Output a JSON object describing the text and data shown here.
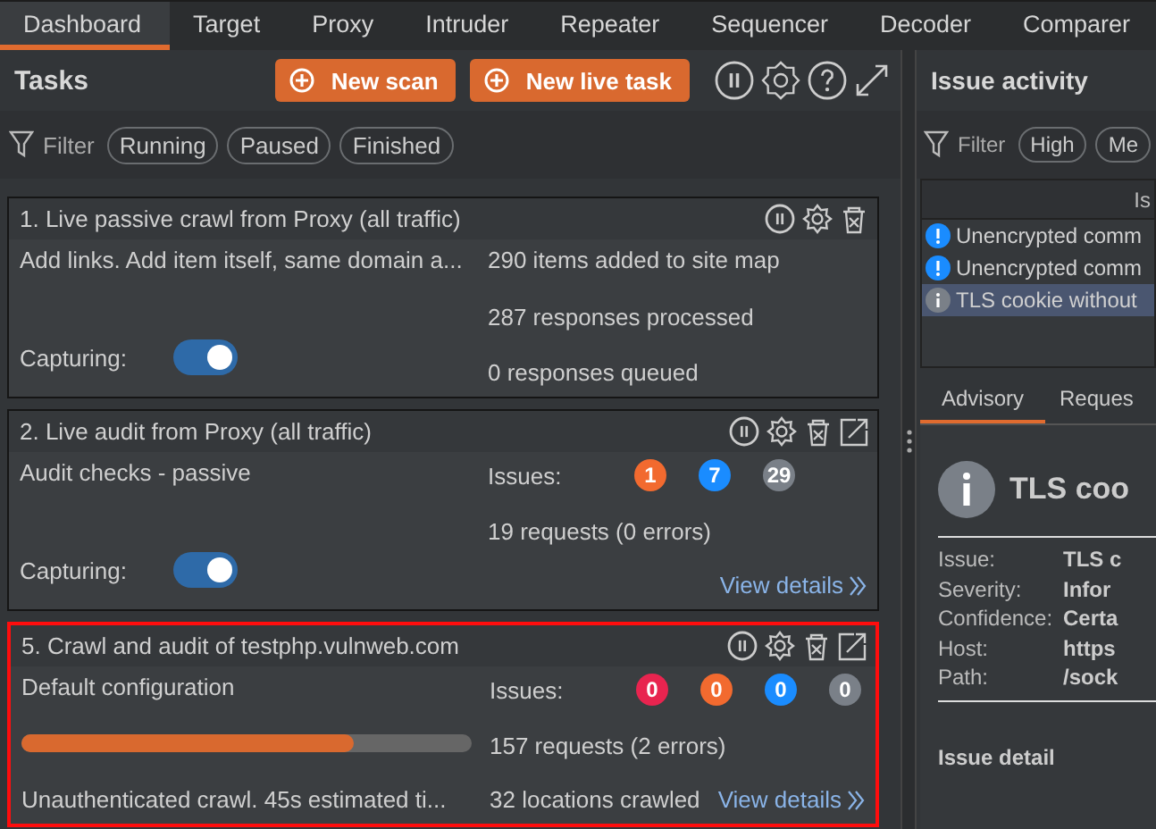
{
  "tabs": [
    {
      "label": "Dashboard",
      "selected": true
    },
    {
      "label": "Target",
      "selected": false
    },
    {
      "label": "Proxy",
      "selected": false
    },
    {
      "label": "Intruder",
      "selected": false
    },
    {
      "label": "Repeater",
      "selected": false
    },
    {
      "label": "Sequencer",
      "selected": false
    },
    {
      "label": "Decoder",
      "selected": false
    },
    {
      "label": "Comparer",
      "selected": false
    }
  ],
  "tasks_panel": {
    "title": "Tasks",
    "buttons": [
      "New scan",
      "New live task"
    ],
    "filter": {
      "label": "Filter",
      "chips": [
        "Running",
        "Paused",
        "Finished"
      ]
    },
    "tasks": [
      {
        "title": "1. Live passive crawl from Proxy (all traffic)",
        "selected": false,
        "popout": false,
        "left": [
          {
            "kind": "text",
            "text": "Add links. Add item itself, same domain a..."
          },
          {
            "kind": "toggle",
            "label": "Capturing:",
            "on": true
          }
        ],
        "right": [
          {
            "kind": "text",
            "text": "290 items added to site map"
          },
          {
            "kind": "text",
            "text": "287 responses processed"
          },
          {
            "kind": "text",
            "text": "0 responses queued"
          }
        ]
      },
      {
        "title": "2. Live audit from Proxy (all traffic)",
        "selected": false,
        "popout": true,
        "left": [
          {
            "kind": "text",
            "text": "Audit checks - passive"
          },
          {
            "kind": "toggle",
            "label": "Capturing:",
            "on": true
          }
        ],
        "right": [
          {
            "kind": "issues",
            "label": "Issues:",
            "counts": [
              {
                "value": "1",
                "color": "#f26a2f"
              },
              {
                "value": "7",
                "color": "#1a8cff"
              },
              {
                "value": "29",
                "color": "#7a8088"
              }
            ]
          },
          {
            "kind": "text",
            "text": "19 requests (0 errors)"
          },
          {
            "kind": "text",
            "link": "View details"
          }
        ]
      },
      {
        "title": "5. Crawl and audit of testphp.vulnweb.com",
        "selected": true,
        "popout": true,
        "left": [
          {
            "kind": "text",
            "text": "Default configuration"
          },
          {
            "kind": "progress",
            "level": 0.74
          },
          {
            "kind": "text",
            "text": "Unauthenticated crawl. 45s estimated ti..."
          }
        ],
        "right": [
          {
            "kind": "issues",
            "label": "Issues:",
            "counts": [
              {
                "value": "0",
                "color": "#e8244f"
              },
              {
                "value": "0",
                "color": "#f26a2f"
              },
              {
                "value": "0",
                "color": "#1a8cff"
              },
              {
                "value": "0",
                "color": "#7a8088"
              }
            ]
          },
          {
            "kind": "text",
            "text": "157 requests (2 errors)"
          },
          {
            "kind": "text",
            "text": "32 locations crawled",
            "link": "View details"
          }
        ]
      }
    ]
  },
  "issue_activity": {
    "title": "Issue activity",
    "filter": {
      "label": "Filter",
      "chips": [
        "High",
        "Me"
      ]
    },
    "table": {
      "column_1": "Is",
      "rows": [
        {
          "text": "Unencrypted comm",
          "color": "#1a8cff",
          "selected": false
        },
        {
          "text": "Unencrypted comm",
          "color": "#1a8cff",
          "selected": false
        },
        {
          "text": "TLS cookie without",
          "color": "#7a8088",
          "selected": true
        }
      ]
    },
    "detail_tabs": [
      {
        "label": "Advisory",
        "selected": true
      },
      {
        "label": "Reques",
        "selected": false
      }
    ],
    "advisory": {
      "title": "TLS coo",
      "fields": [
        {
          "label": "Issue:",
          "value": "TLS c"
        },
        {
          "label": "Severity:",
          "value": "Infor"
        },
        {
          "label": "Confidence:",
          "value": "Certa"
        },
        {
          "label": "Host:",
          "value": "https"
        },
        {
          "label": "Path:",
          "value": "/sock"
        }
      ],
      "section": "Issue detail"
    }
  }
}
